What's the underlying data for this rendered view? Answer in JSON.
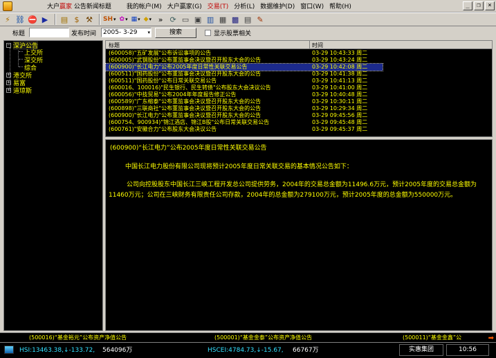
{
  "app": {
    "title_prefix": "大户",
    "title_brand": "赢家",
    "title_suffix": " 公告新闻标题"
  },
  "menu": [
    {
      "label": "我的帐户(M)"
    },
    {
      "label": "大户赢家(G)"
    },
    {
      "label": "交易(T)"
    },
    {
      "label": "分析(L)"
    },
    {
      "label": "数据维护(D)"
    },
    {
      "label": "窗口(W)"
    },
    {
      "label": "帮助(H)"
    }
  ],
  "toolbar": {
    "sh_label": "SH",
    "chevron": "»"
  },
  "search": {
    "title_label": "标题",
    "title_value": "",
    "date_label": "发布时间",
    "date_value": "2005- 3-29",
    "button_label": "搜索",
    "related_label": "显示股票相关"
  },
  "tree": {
    "root": "深沪公告",
    "children": [
      "上交所",
      "深交所",
      "综合"
    ],
    "siblings": [
      "港交所",
      "易富",
      "道琼斯"
    ]
  },
  "list": {
    "col_title": "标题",
    "col_time": "时间",
    "rows": [
      {
        "title": "(600058)\"五矿发展\"公布诉讼事项的公告",
        "time": "03-29 10:43:33 周二"
      },
      {
        "title": "(600005)\"武钢股份\"公布董监事会决议暨召开股东大会的公告",
        "time": "03-29 10:43:24 周二"
      },
      {
        "title": "(600900)\"长江电力\"公布2005年度日常性关联交易公告",
        "time": "03-29 10:42:08 周二"
      },
      {
        "title": "(600511)\"国药股份\"公布董监事会决议暨召开股东大会的公告",
        "time": "03-29 10:41:38 周二"
      },
      {
        "title": "(600511)\"国药股份\"公布日常关联交易公告",
        "time": "03-29 10:41:13 周二"
      },
      {
        "title": "(600016、100016)\"民生银行、民生转债\"公布股东大会决议公告",
        "time": "03-29 10:41:00 周二"
      },
      {
        "title": "(600056)\"中技贸易\"公布2004年年度报告修正公告",
        "time": "03-29 10:40:48 周二"
      },
      {
        "title": "(600589)\"广东榕泰\"公布董监事会决议暨召开股东大会的公告",
        "time": "03-29 10:30:11 周二"
      },
      {
        "title": "(600898)\"三联商社\"公布董监事会决议暨召开股东大会的公告",
        "time": "03-29 10:29:34 周二"
      },
      {
        "title": "(600900)\"长江电力\"公布董监事会决议暨召开股东大会的公告",
        "time": "03-29 09:45:56 周二"
      },
      {
        "title": "(600754、900934)\"锦江酒店、锦江B股\"公布日常关联交易公告",
        "time": "03-29 09:45:48 周二"
      },
      {
        "title": "(600761)\"安徽合力\"公布股东大会决议公告",
        "time": "03-29 09:45:37 周二"
      }
    ]
  },
  "article": {
    "title": "(600900)“长江电力”公布2005年度日常性关联交易公告",
    "p1": "中国长江电力股份有限公司现将预计2005年度日常关联交易的基本情况公告如下：",
    "p2": "公司向控股股东中国长江三峡工程开发总公司提供劳务，2004年的交易总金额为11496.6万元，预计2005年度的交易总金额为11460万元；公司在三峡财务有限责任公司存款，2004年的总金额为279100万元，预计2005年度的总金额为550000万元。"
  },
  "ticker": [
    "(500016)“基金裕元”公布资产净值公告",
    "(500001)“基金金泰”公布资产净值公告",
    "(500011)“基金金鑫”公"
  ],
  "status": {
    "hsi_label": "HSI:13463.38,↓-133.72,",
    "hsi_vol": "564096万",
    "hscei_label": "HSCEI:4784.73,↓-15.67,",
    "hscei_vol": "66767万",
    "group": "实惠集团",
    "clock": "10:56"
  },
  "colors": {
    "text_yellow": "#ffff00",
    "selected_bg": "#1c2a8c",
    "index_cyan": "#33e0ff",
    "down_green": "#22ee22",
    "brand_red": "#c00000"
  }
}
